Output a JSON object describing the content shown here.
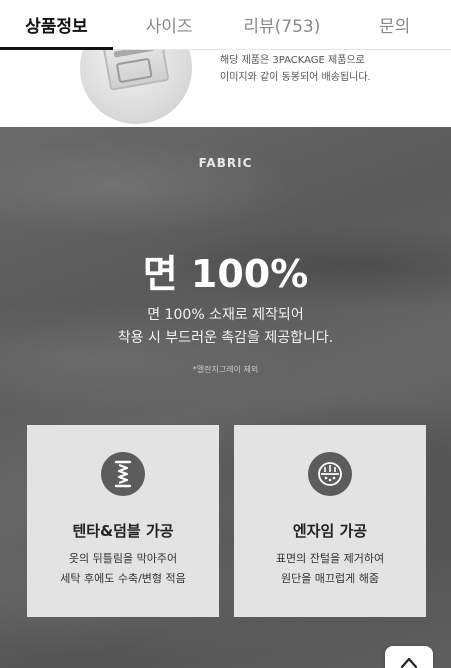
{
  "tabs": [
    {
      "label": "상품정보",
      "active": true
    },
    {
      "label": "사이즈",
      "active": false
    },
    {
      "label": "리뷰(753)",
      "active": false
    },
    {
      "label": "문의",
      "active": false
    }
  ],
  "notice": {
    "line1": "해당 제품은 3PACKAGE 제품으로",
    "line2": "이미지와 같이 동봉되어 배송됩니다."
  },
  "fabric": {
    "label": "FABRIC",
    "title": "면 100%",
    "desc_line1": "면 100% 소재로 제작되어",
    "desc_line2": "착용 시 부드러운 촉감을 제공합니다.",
    "note": "*멜란지그레이 제외"
  },
  "cards": [
    {
      "icon": "thread-icon",
      "title": "텐타&덤블 가공",
      "line1": "옷의 뒤틀림을 막아주어",
      "line2": "세탁 후에도 수축/변형 적음"
    },
    {
      "icon": "enzyme-icon",
      "title": "엔자임 가공",
      "line1": "표면의 잔털을 제거하여",
      "line2": "원단을 매끄럽게 해줌"
    }
  ],
  "colors": {
    "tab_active": "#111111",
    "tab_inactive": "#8a8a8a",
    "card_bg": "#e3e3e3",
    "icon_circle": "#5c5c5c"
  },
  "scroll_top_icon": "arrow-up-icon"
}
